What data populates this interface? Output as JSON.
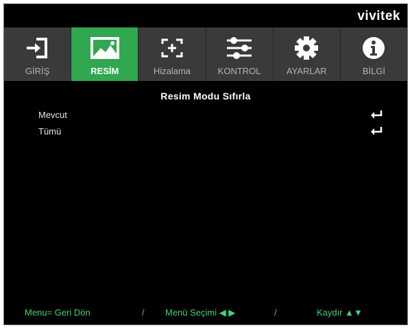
{
  "brand": "vivitek",
  "tabs": [
    {
      "label": "GİRİŞ",
      "icon": "input-arrow-icon",
      "active": false
    },
    {
      "label": "RESİM",
      "icon": "picture-icon",
      "active": true
    },
    {
      "label": "Hizalama",
      "icon": "alignment-crosshair-icon",
      "active": false
    },
    {
      "label": "KONTROL",
      "icon": "sliders-icon",
      "active": false
    },
    {
      "label": "AYARLAR",
      "icon": "gear-icon",
      "active": false
    },
    {
      "label": "BİLGİ",
      "icon": "info-icon",
      "active": false
    }
  ],
  "panel": {
    "title": "Resim Modu Sıfırla",
    "items": [
      {
        "label": "Mevcut",
        "icon": "enter-icon"
      },
      {
        "label": "Tümü",
        "icon": "enter-icon"
      }
    ]
  },
  "footer": {
    "back": "Menu= Geri Dön",
    "sep1": "/",
    "select": "Menü Seçimi ◀ ▶",
    "sep2": "/",
    "scroll": "Kaydır ▲▼"
  },
  "colors": {
    "accent": "#2fa84f",
    "tab_bg": "#3a3a3a",
    "footer_text": "#3fd47a"
  }
}
